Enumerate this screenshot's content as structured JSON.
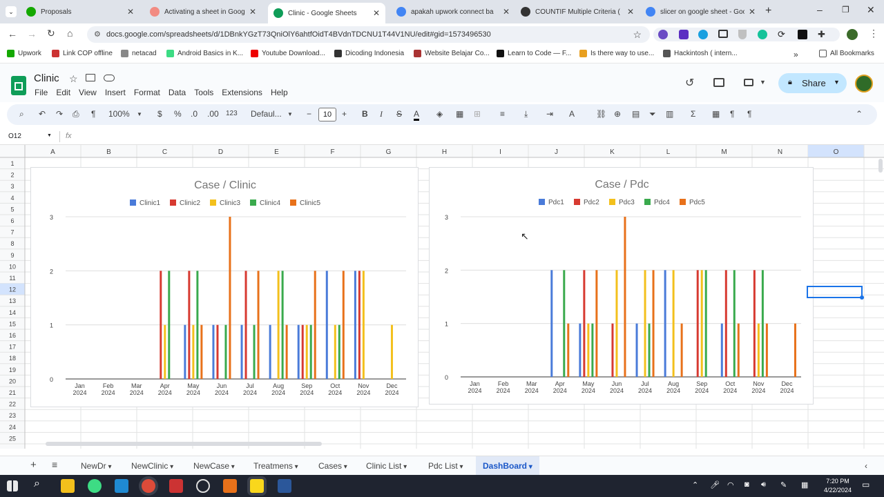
{
  "browser": {
    "tabs": [
      {
        "label": "Proposals",
        "color": "#14a800"
      },
      {
        "label": "Activating a sheet in Google",
        "color": "#f28b82"
      },
      {
        "label": "Clinic - Google Sheets",
        "color": "#0f9d58"
      },
      {
        "label": "apakah upwork connect ba",
        "color": "#4285f4"
      },
      {
        "label": "COUNTIF Multiple Criteria (",
        "color": "#333333"
      },
      {
        "label": "slicer on google sheet - Goo",
        "color": "#4285f4"
      }
    ],
    "url": "docs.google.com/spreadsheets/d/1DBnkYGzT73QniOlY6ahtfOidT4BVdnTDCNU1T44V1NU/edit#gid=1573496530",
    "bookmarks": [
      "Upwork",
      "Link COP offline",
      "netacad",
      "Android Basics in K...",
      "Youtube Download...",
      "Dicoding Indonesia",
      "Website Belajar Co...",
      "Learn to Code — F...",
      "Is there way to use...",
      "Hackintosh ( intern..."
    ],
    "all_bookmarks": "All Bookmarks"
  },
  "app": {
    "doc_title": "Clinic",
    "menu": [
      "File",
      "Edit",
      "View",
      "Insert",
      "Format",
      "Data",
      "Tools",
      "Extensions",
      "Help"
    ],
    "share_label": "Share",
    "zoom": "100%",
    "font": "Defaul...",
    "font_size": "10",
    "currency": "$",
    "percent": "%",
    "dec_dec": ".0",
    "dec_inc": ".00",
    "num_fmt": "123",
    "cell_ref": "O12",
    "fx": "fx"
  },
  "grid": {
    "columns": [
      "A",
      "B",
      "C",
      "D",
      "E",
      "F",
      "G",
      "H",
      "I",
      "J",
      "K",
      "L",
      "M",
      "N",
      "O"
    ],
    "rows": [
      "1",
      "2",
      "3",
      "4",
      "5",
      "6",
      "7",
      "8",
      "9",
      "10",
      "11",
      "12",
      "13",
      "14",
      "15",
      "16",
      "17",
      "18",
      "19",
      "20",
      "21",
      "22",
      "23",
      "24",
      "25"
    ],
    "selected_col": "O",
    "selected_row": "12"
  },
  "sheet_tabs": [
    "NewDr",
    "NewClinic",
    "NewCase",
    "Treatmens",
    "Cases",
    "Clinic List",
    "Pdc List",
    "DashBoard"
  ],
  "active_sheet": "DashBoard",
  "taskbar": {
    "time": "7:20 PM",
    "date": "4/22/2024"
  },
  "chart_data": [
    {
      "type": "bar",
      "title": "Case / Clinic",
      "categories": [
        "Jan 2024",
        "Feb 2024",
        "Mar 2024",
        "Apr 2024",
        "May 2024",
        "Jun 2024",
        "Jul 2024",
        "Aug 2024",
        "Sep 2024",
        "Oct 2024",
        "Nov 2024",
        "Dec 2024"
      ],
      "cat_line1": [
        "Jan",
        "Feb",
        "Mar",
        "Apr",
        "May",
        "Jun",
        "Jul",
        "Aug",
        "Sep",
        "Oct",
        "Nov",
        "Dec"
      ],
      "cat_line2": "2024",
      "yticks": [
        "0",
        "1",
        "2",
        "3"
      ],
      "ylim": [
        0,
        3
      ],
      "legend_position": "top",
      "series": [
        {
          "name": "Clinic1",
          "color": "#4a7bd9",
          "values": [
            0,
            0,
            0,
            0,
            1,
            1,
            1,
            1,
            1,
            2,
            2,
            0
          ]
        },
        {
          "name": "Clinic2",
          "color": "#d73a31",
          "values": [
            0,
            0,
            0,
            2,
            2,
            1,
            2,
            0,
            1,
            0,
            2,
            0
          ]
        },
        {
          "name": "Clinic3",
          "color": "#f3c01c",
          "values": [
            0,
            0,
            0,
            1,
            1,
            0,
            0,
            2,
            1,
            1,
            2,
            1
          ]
        },
        {
          "name": "Clinic4",
          "color": "#3aaa4d",
          "values": [
            0,
            0,
            0,
            2,
            2,
            1,
            1,
            2,
            1,
            1,
            0,
            0
          ]
        },
        {
          "name": "Clinic5",
          "color": "#e8711a",
          "values": [
            0,
            0,
            0,
            0,
            1,
            3,
            2,
            1,
            2,
            2,
            0,
            0
          ]
        }
      ]
    },
    {
      "type": "bar",
      "title": "Case / Pdc",
      "categories": [
        "Jan 2024",
        "Feb 2024",
        "Mar 2024",
        "Apr 2024",
        "May 2024",
        "Jun 2024",
        "Jul 2024",
        "Aug 2024",
        "Sep 2024",
        "Oct 2024",
        "Nov 2024",
        "Dec 2024"
      ],
      "cat_line1": [
        "Jan",
        "Feb",
        "Mar",
        "Apr",
        "May",
        "Jun",
        "Jul",
        "Aug",
        "Sep",
        "Oct",
        "Nov",
        "Dec"
      ],
      "cat_line2": "2024",
      "yticks": [
        "0",
        "1",
        "2",
        "3"
      ],
      "ylim": [
        0,
        3
      ],
      "legend_position": "top",
      "series": [
        {
          "name": "Pdc1",
          "color": "#4a7bd9",
          "values": [
            0,
            0,
            0,
            2,
            1,
            0,
            1,
            2,
            0,
            1,
            0,
            0
          ]
        },
        {
          "name": "Pdc2",
          "color": "#d73a31",
          "values": [
            0,
            0,
            0,
            0,
            2,
            1,
            0,
            0,
            2,
            2,
            2,
            0
          ]
        },
        {
          "name": "Pdc3",
          "color": "#f3c01c",
          "values": [
            0,
            0,
            0,
            0,
            1,
            2,
            2,
            2,
            2,
            0,
            1,
            0
          ]
        },
        {
          "name": "Pdc4",
          "color": "#3aaa4d",
          "values": [
            0,
            0,
            0,
            2,
            1,
            0,
            1,
            0,
            2,
            2,
            2,
            0
          ]
        },
        {
          "name": "Pdc5",
          "color": "#e8711a",
          "values": [
            0,
            0,
            0,
            1,
            2,
            3,
            2,
            1,
            0,
            1,
            1,
            1
          ]
        }
      ]
    }
  ]
}
